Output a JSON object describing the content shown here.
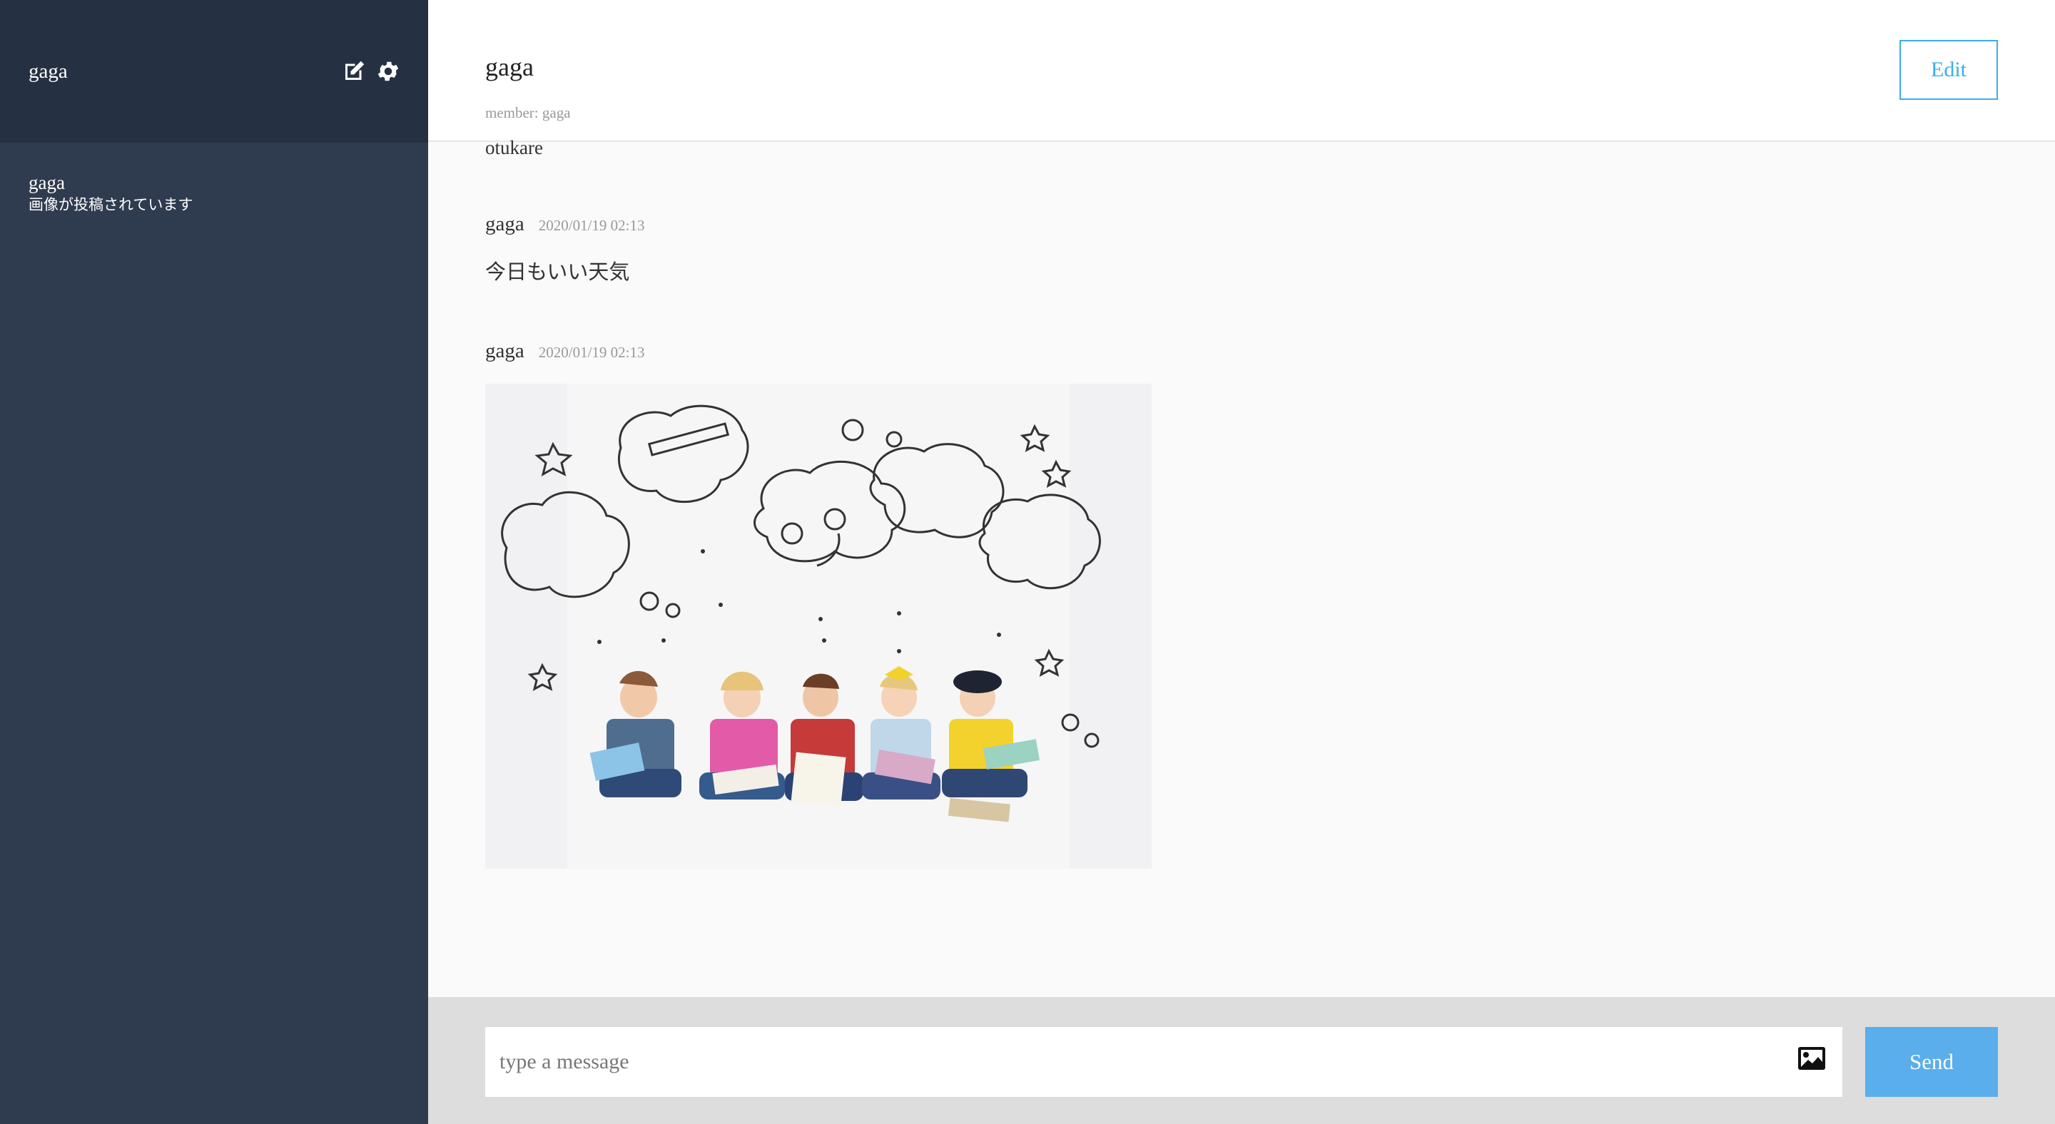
{
  "sidebar": {
    "user_name": "gaga",
    "icons": [
      "edit-icon",
      "gear-icon"
    ],
    "groups": [
      {
        "name": "gaga",
        "last_message": "画像が投稿されています"
      }
    ]
  },
  "chat": {
    "group_name": "gaga",
    "members": "member: gaga",
    "edit_label": "Edit"
  },
  "messages": [
    {
      "text": "otukare"
    },
    {
      "user": "gaga",
      "date": "2020/01/19 02:13",
      "text": "今日もいい天気"
    },
    {
      "user": "gaga",
      "date": "2020/01/19 02:13",
      "image": "children-reading-illustration"
    }
  ],
  "composer": {
    "placeholder": "type a message",
    "image_icon": "image-icon",
    "send_label": "Send"
  },
  "colors": {
    "sidebar_bg": "#2f3b4f",
    "sidebar_header_bg": "#253142",
    "accent": "#38aef0",
    "send_bg": "#5aaeeb"
  }
}
